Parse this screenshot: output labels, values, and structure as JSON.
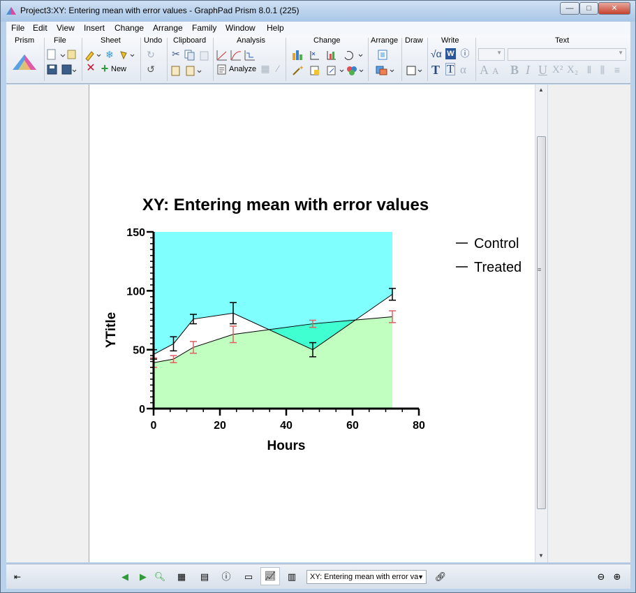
{
  "window": {
    "title": "Project3:XY: Entering mean with error values - GraphPad Prism 8.0.1 (225)",
    "minimize_glyph": "—",
    "maximize_glyph": "□",
    "close_glyph": "✕"
  },
  "menu": [
    "File",
    "Edit",
    "View",
    "Insert",
    "Change",
    "Arrange",
    "Family",
    "Window",
    "Help"
  ],
  "ribbon": {
    "groups": [
      "Prism",
      "File",
      "Sheet",
      "Undo",
      "Clipboard",
      "Analysis",
      "Change",
      "Arrange",
      "Draw",
      "Write",
      "Text"
    ],
    "new_label": "New",
    "analyze_label": "Analyze",
    "write_glyphs": {
      "sqrt": "√α",
      "word": "W",
      "bold_t": "T",
      "plain_t": "T",
      "alpha": "α"
    },
    "text_glyphs": {
      "a_big": "A",
      "a_small": "A",
      "bold": "B",
      "italic": "I",
      "underline": "U",
      "sup": "X²",
      "sub": "X₂"
    }
  },
  "chart_data": {
    "type": "line",
    "title": "XY: Entering mean with error values",
    "xlabel": "Hours",
    "ylabel": "YTitle",
    "xlim": [
      0,
      80
    ],
    "ylim": [
      0,
      150
    ],
    "xticks": [
      0,
      20,
      40,
      60,
      80
    ],
    "yticks": [
      0,
      50,
      100,
      150
    ],
    "legend_position": "right",
    "fill_colors": {
      "above": "#80ffff",
      "between": "#40ffd0",
      "below": "#c0ffc0"
    },
    "series": [
      {
        "name": "Control",
        "color": "#000000",
        "x": [
          0,
          6,
          12,
          24,
          48,
          72
        ],
        "y": [
          46,
          55,
          76,
          81,
          50,
          97
        ],
        "err": [
          4,
          6,
          4,
          9,
          6,
          5
        ]
      },
      {
        "name": "Treated",
        "color": "#000000",
        "err_color": "#e06060",
        "x": [
          0,
          6,
          12,
          24,
          48,
          72
        ],
        "y": [
          39,
          42,
          52,
          63,
          72,
          78
        ],
        "err": [
          4,
          3,
          5,
          7,
          3,
          5
        ]
      }
    ]
  },
  "bottombar": {
    "sheet_name": "XY: Entering mean with error va"
  }
}
